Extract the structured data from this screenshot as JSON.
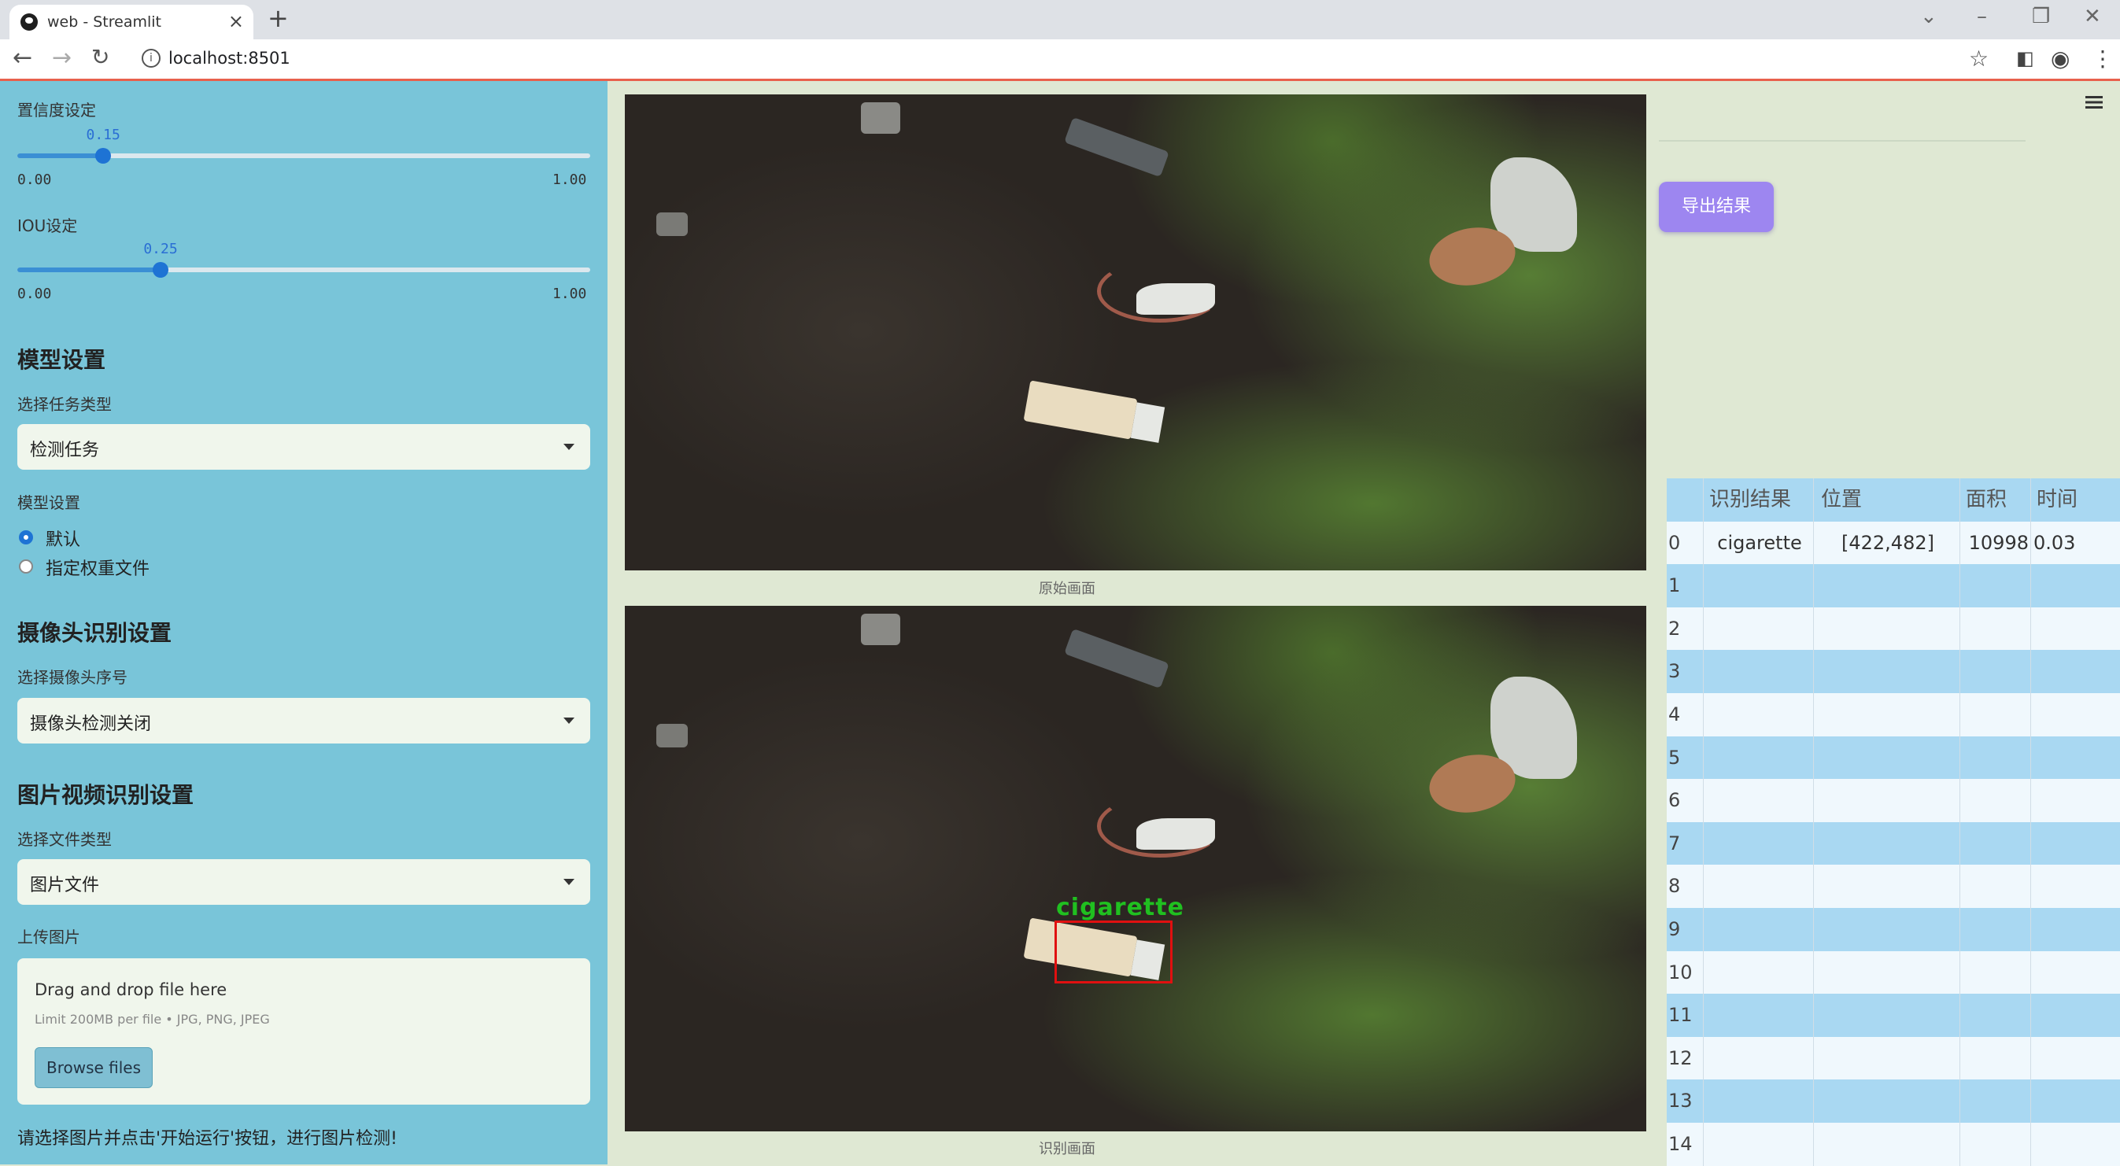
{
  "browser": {
    "tab_title": "web - Streamlit",
    "url": "localhost:8501"
  },
  "sidebar": {
    "conf": {
      "label": "置信度设定",
      "value": "0.15",
      "value_fraction": 0.15,
      "min": "0.00",
      "max": "1.00"
    },
    "iou": {
      "label": "IOU设定",
      "value": "0.25",
      "value_fraction": 0.25,
      "min": "0.00",
      "max": "1.00"
    },
    "model_section": "模型设置",
    "task_label": "选择任务类型",
    "task_value": "检测任务",
    "model_label": "模型设置",
    "radio_default": "默认",
    "radio_custom": "指定权重文件",
    "camera_section": "摄像头识别设置",
    "camera_label": "选择摄像头序号",
    "camera_value": "摄像头检测关闭",
    "media_section": "图片视频识别设置",
    "filetype_label": "选择文件类型",
    "filetype_value": "图片文件",
    "upload_label": "上传图片",
    "dropzone_title": "Drag and drop file here",
    "dropzone_limit": "Limit 200MB per file • JPG, PNG, JPEG",
    "browse_label": "Browse files",
    "hint": "请选择图片并点击'开始运行'按钮，进行图片检测!"
  },
  "images": {
    "original_caption": "原始画面",
    "detected_caption": "识别画面",
    "detection_label": "cigarette"
  },
  "right": {
    "export_label": "导出结果",
    "table": {
      "headers": [
        "识别结果",
        "位置",
        "面积",
        "时间"
      ],
      "rows": [
        {
          "idx": "0",
          "result": "cigarette",
          "pos": "[422,482]",
          "area": "10998",
          "time": "0.03"
        },
        {
          "idx": "1"
        },
        {
          "idx": "2"
        },
        {
          "idx": "3"
        },
        {
          "idx": "4"
        },
        {
          "idx": "5"
        },
        {
          "idx": "6"
        },
        {
          "idx": "7"
        },
        {
          "idx": "8"
        },
        {
          "idx": "9"
        },
        {
          "idx": "10"
        },
        {
          "idx": "11"
        },
        {
          "idx": "12"
        },
        {
          "idx": "13"
        },
        {
          "idx": "14"
        }
      ]
    }
  }
}
